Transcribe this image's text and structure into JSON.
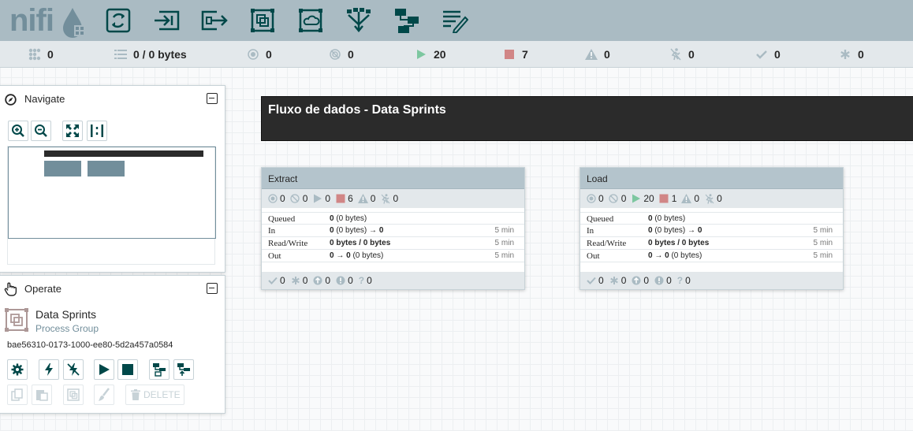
{
  "app": {
    "logo": "nifi"
  },
  "toolbar": {
    "buttons": [
      {
        "icon": "processor-icon"
      },
      {
        "icon": "input-port-icon"
      },
      {
        "icon": "output-port-icon"
      },
      {
        "icon": "process-group-icon"
      },
      {
        "icon": "remote-process-group-icon"
      },
      {
        "icon": "funnel-icon"
      },
      {
        "icon": "template-icon"
      },
      {
        "icon": "label-icon"
      }
    ]
  },
  "statusbar": {
    "cluster_count": "0",
    "queued": "0 / 0 bytes",
    "transmitting": "0",
    "not_transmitting": "0",
    "running": "20",
    "stopped": "7",
    "invalid": "0",
    "disabled": "0",
    "up_to_date": "0",
    "locally_modified": "0",
    "colors": {
      "running": "#7dc7a0",
      "stopped": "#d18686"
    }
  },
  "navigate": {
    "title": "Navigate"
  },
  "operate": {
    "title": "Operate",
    "component_name": "Data Sprints",
    "component_type": "Process Group",
    "component_id": "bae56310-0173-1000-ee80-5d2a457a0584",
    "delete_label": "DELETE"
  },
  "canvas": {
    "label_text": "Fluxo de dados - Data Sprints",
    "groups": [
      {
        "name": "Extract",
        "counts": {
          "transmitting": "0",
          "not_transmitting": "0",
          "running": "0",
          "stopped": "6",
          "invalid": "0",
          "disabled": "0"
        },
        "queued_value": "0",
        "queued_extra": "(0 bytes)",
        "in_value": "0",
        "in_extra": "(0 bytes) →",
        "in_value2": "0",
        "in_time": "5 min",
        "rw_value": "0 bytes / 0 bytes",
        "rw_time": "5 min",
        "out_value": "0 → 0",
        "out_extra": "(0 bytes)",
        "out_time": "5 min",
        "foot": {
          "up_to_date": "0",
          "locally_modified": "0",
          "stale": "0",
          "errors": "0",
          "unknown": "0"
        }
      },
      {
        "name": "Load",
        "counts": {
          "transmitting": "0",
          "not_transmitting": "0",
          "running": "20",
          "stopped": "1",
          "invalid": "0",
          "disabled": "0"
        },
        "queued_value": "0",
        "queued_extra": "(0 bytes)",
        "in_value": "0",
        "in_extra": "(0 bytes) →",
        "in_value2": "0",
        "in_time": "5 min",
        "rw_value": "0 bytes / 0 bytes",
        "rw_time": "5 min",
        "out_value": "0 → 0",
        "out_extra": "(0 bytes)",
        "out_time": "5 min",
        "foot": {
          "up_to_date": "0",
          "locally_modified": "0",
          "stale": "0",
          "errors": "0",
          "unknown": "0"
        }
      }
    ],
    "labels": {
      "queued": "Queued",
      "in": "In",
      "read_write": "Read/Write",
      "out": "Out"
    }
  }
}
